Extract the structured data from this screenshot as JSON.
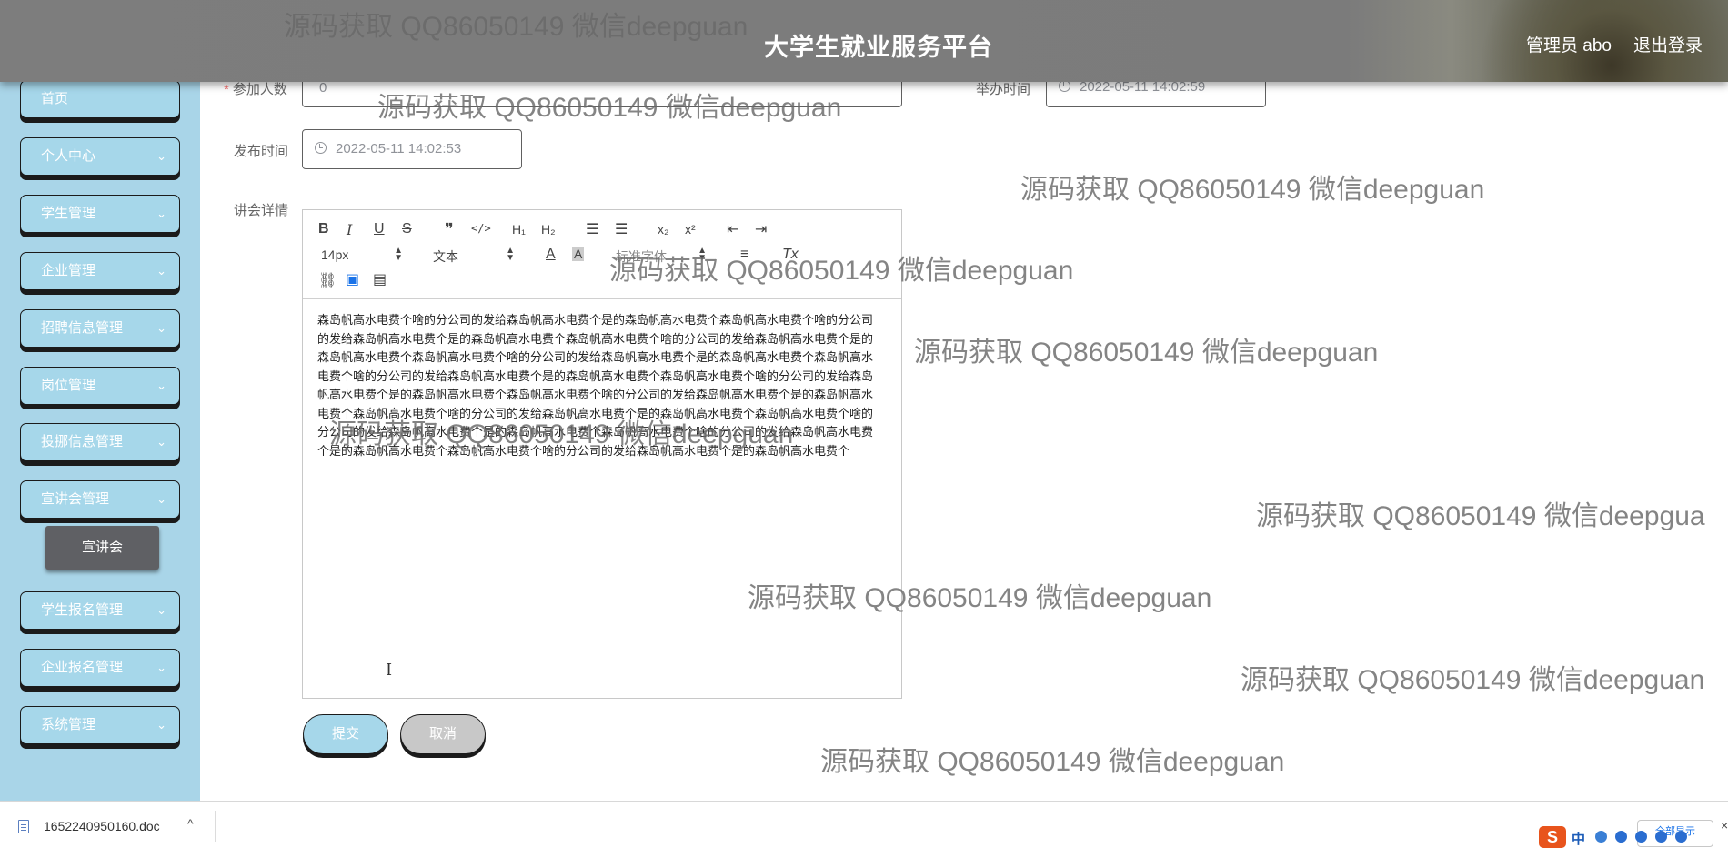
{
  "header": {
    "title": "大学生就业服务平台",
    "admin": "管理员 abo",
    "logout": "退出登录"
  },
  "sidebar": {
    "items": [
      {
        "label": "首页",
        "has_children": false
      },
      {
        "label": "个人中心",
        "has_children": true
      },
      {
        "label": "学生管理",
        "has_children": true
      },
      {
        "label": "企业管理",
        "has_children": true
      },
      {
        "label": "招聘信息管理",
        "has_children": true
      },
      {
        "label": "岗位管理",
        "has_children": true
      },
      {
        "label": "投挪信息管理",
        "has_children": true
      },
      {
        "label": "宣讲会管理",
        "has_children": true
      },
      {
        "label": "学生报名管理",
        "has_children": true
      },
      {
        "label": "企业报名管理",
        "has_children": true
      },
      {
        "label": "系统管理",
        "has_children": true
      }
    ],
    "submenu": {
      "label": "宣讲会"
    },
    "chevron": "⌄"
  },
  "form": {
    "participants": {
      "label": "参加人数",
      "required_mark": "*",
      "value": "0"
    },
    "hold_time": {
      "label": "举办时间",
      "value": "2022-05-11 14:02:59"
    },
    "publish_time": {
      "label": "发布时间",
      "value": "2022-05-11 14:02:53"
    },
    "details": {
      "label": "讲会详情",
      "content": "森岛帆高水电费个啥的分公司的发给森岛帆高水电费个是的森岛帆高水电费个森岛帆高水电费个啥的分公司的发给森岛帆高水电费个是的森岛帆高水电费个森岛帆高水电费个啥的分公司的发给森岛帆高水电费个是的森岛帆高水电费个森岛帆高水电费个啥的分公司的发给森岛帆高水电费个是的森岛帆高水电费个森岛帆高水电费个啥的分公司的发给森岛帆高水电费个是的森岛帆高水电费个森岛帆高水电费个啥的分公司的发给森岛帆高水电费个是的森岛帆高水电费个森岛帆高水电费个啥的分公司的发给森岛帆高水电费个是的森岛帆高水电费个森岛帆高水电费个啥的分公司的发给森岛帆高水电费个是的森岛帆高水电费个森岛帆高水电费个啥的分公司的发给森岛帆高水电费个是的森岛帆高水电费个森岛帆高水电费个啥的分公司的发给森岛帆高水电费个是的森岛帆高水电费个森岛帆高水电费个啥的分公司的发给森岛帆高水电费个是的森岛帆高水电费个"
    },
    "submit": "提交",
    "cancel": "取消"
  },
  "editor_toolbar": {
    "bold": "B",
    "italic": "I",
    "underline": "U",
    "strike": "S",
    "quote": "❞",
    "code": "</>",
    "h1": "H₁",
    "h2": "H₂",
    "ordered_list": "☰",
    "bullet_list": "☰",
    "subscript": "x₂",
    "superscript": "x²",
    "outdent": "⇤",
    "indent": "⇥",
    "font_size": "14px",
    "text_type": "文本",
    "font_family": "标准字体",
    "align": "≡",
    "clear_format": "Tx",
    "link": "⛓",
    "image": "▣",
    "video": "▤"
  },
  "watermark": "源码获取 QQ86050149 微信deepguan",
  "watermark_cut": "源码获取 QQ86050149 微信deepgua",
  "download_bar": {
    "file_name": "1652240950160.doc",
    "caret": "^",
    "show_all": "全部显示",
    "close": "×"
  },
  "tray": {
    "logo": "S",
    "lang": "中"
  }
}
